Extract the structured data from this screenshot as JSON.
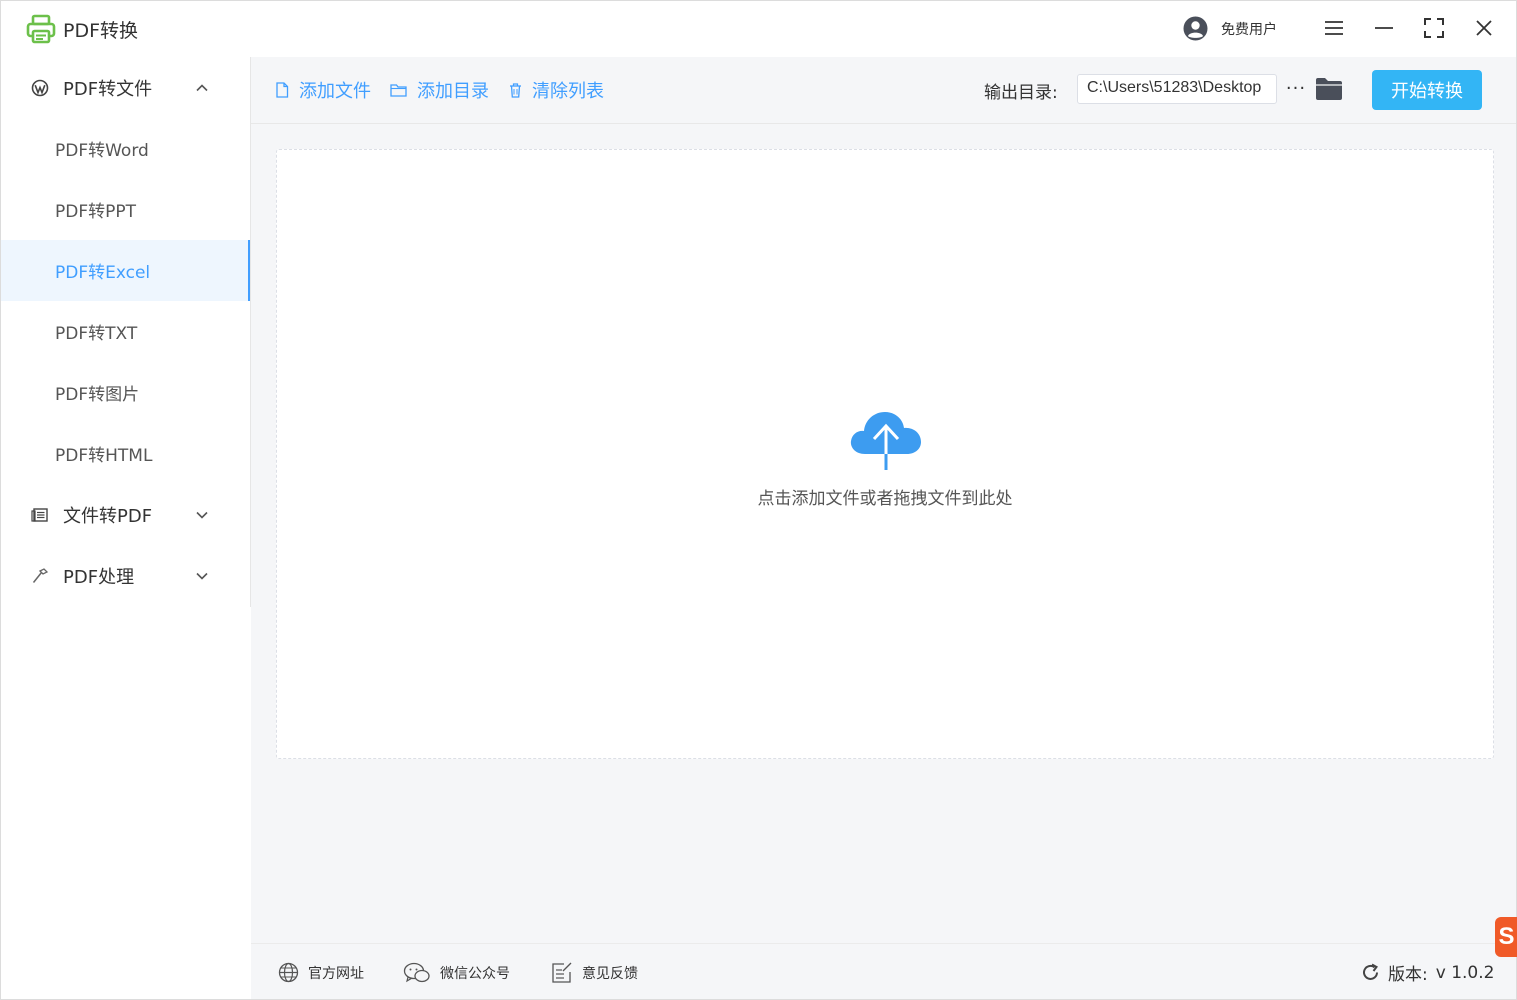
{
  "app": {
    "title": "PDF转换",
    "user_label": "免费用户"
  },
  "sidebar": {
    "groups": [
      {
        "label": "PDF转文件",
        "icon": "wordpress-icon",
        "expanded": true,
        "items": [
          {
            "label": "PDF转Word"
          },
          {
            "label": "PDF转PPT"
          },
          {
            "label": "PDF转Excel",
            "active": true
          },
          {
            "label": "PDF转TXT"
          },
          {
            "label": "PDF转图片"
          },
          {
            "label": "PDF转HTML"
          }
        ]
      },
      {
        "label": "文件转PDF",
        "icon": "document-icon",
        "expanded": false
      },
      {
        "label": "PDF处理",
        "icon": "hammer-icon",
        "expanded": false
      }
    ]
  },
  "toolbar": {
    "add_file": "添加文件",
    "add_folder": "添加目录",
    "clear_list": "清除列表",
    "output_label": "输出目录:",
    "output_path": "C:\\Users\\51283\\Desktop",
    "more": "···",
    "start": "开始转换"
  },
  "dropzone": {
    "hint": "点击添加文件或者拖拽文件到此处"
  },
  "footer": {
    "website": "官方网址",
    "wechat": "微信公众号",
    "feedback": "意见反馈",
    "version_label": "版本:",
    "version_value": "v 1.0.2"
  },
  "colors": {
    "accent": "#409eff",
    "start_button": "#33b5f5",
    "logo_green": "#6cc04a",
    "badge": "#f05a28"
  }
}
